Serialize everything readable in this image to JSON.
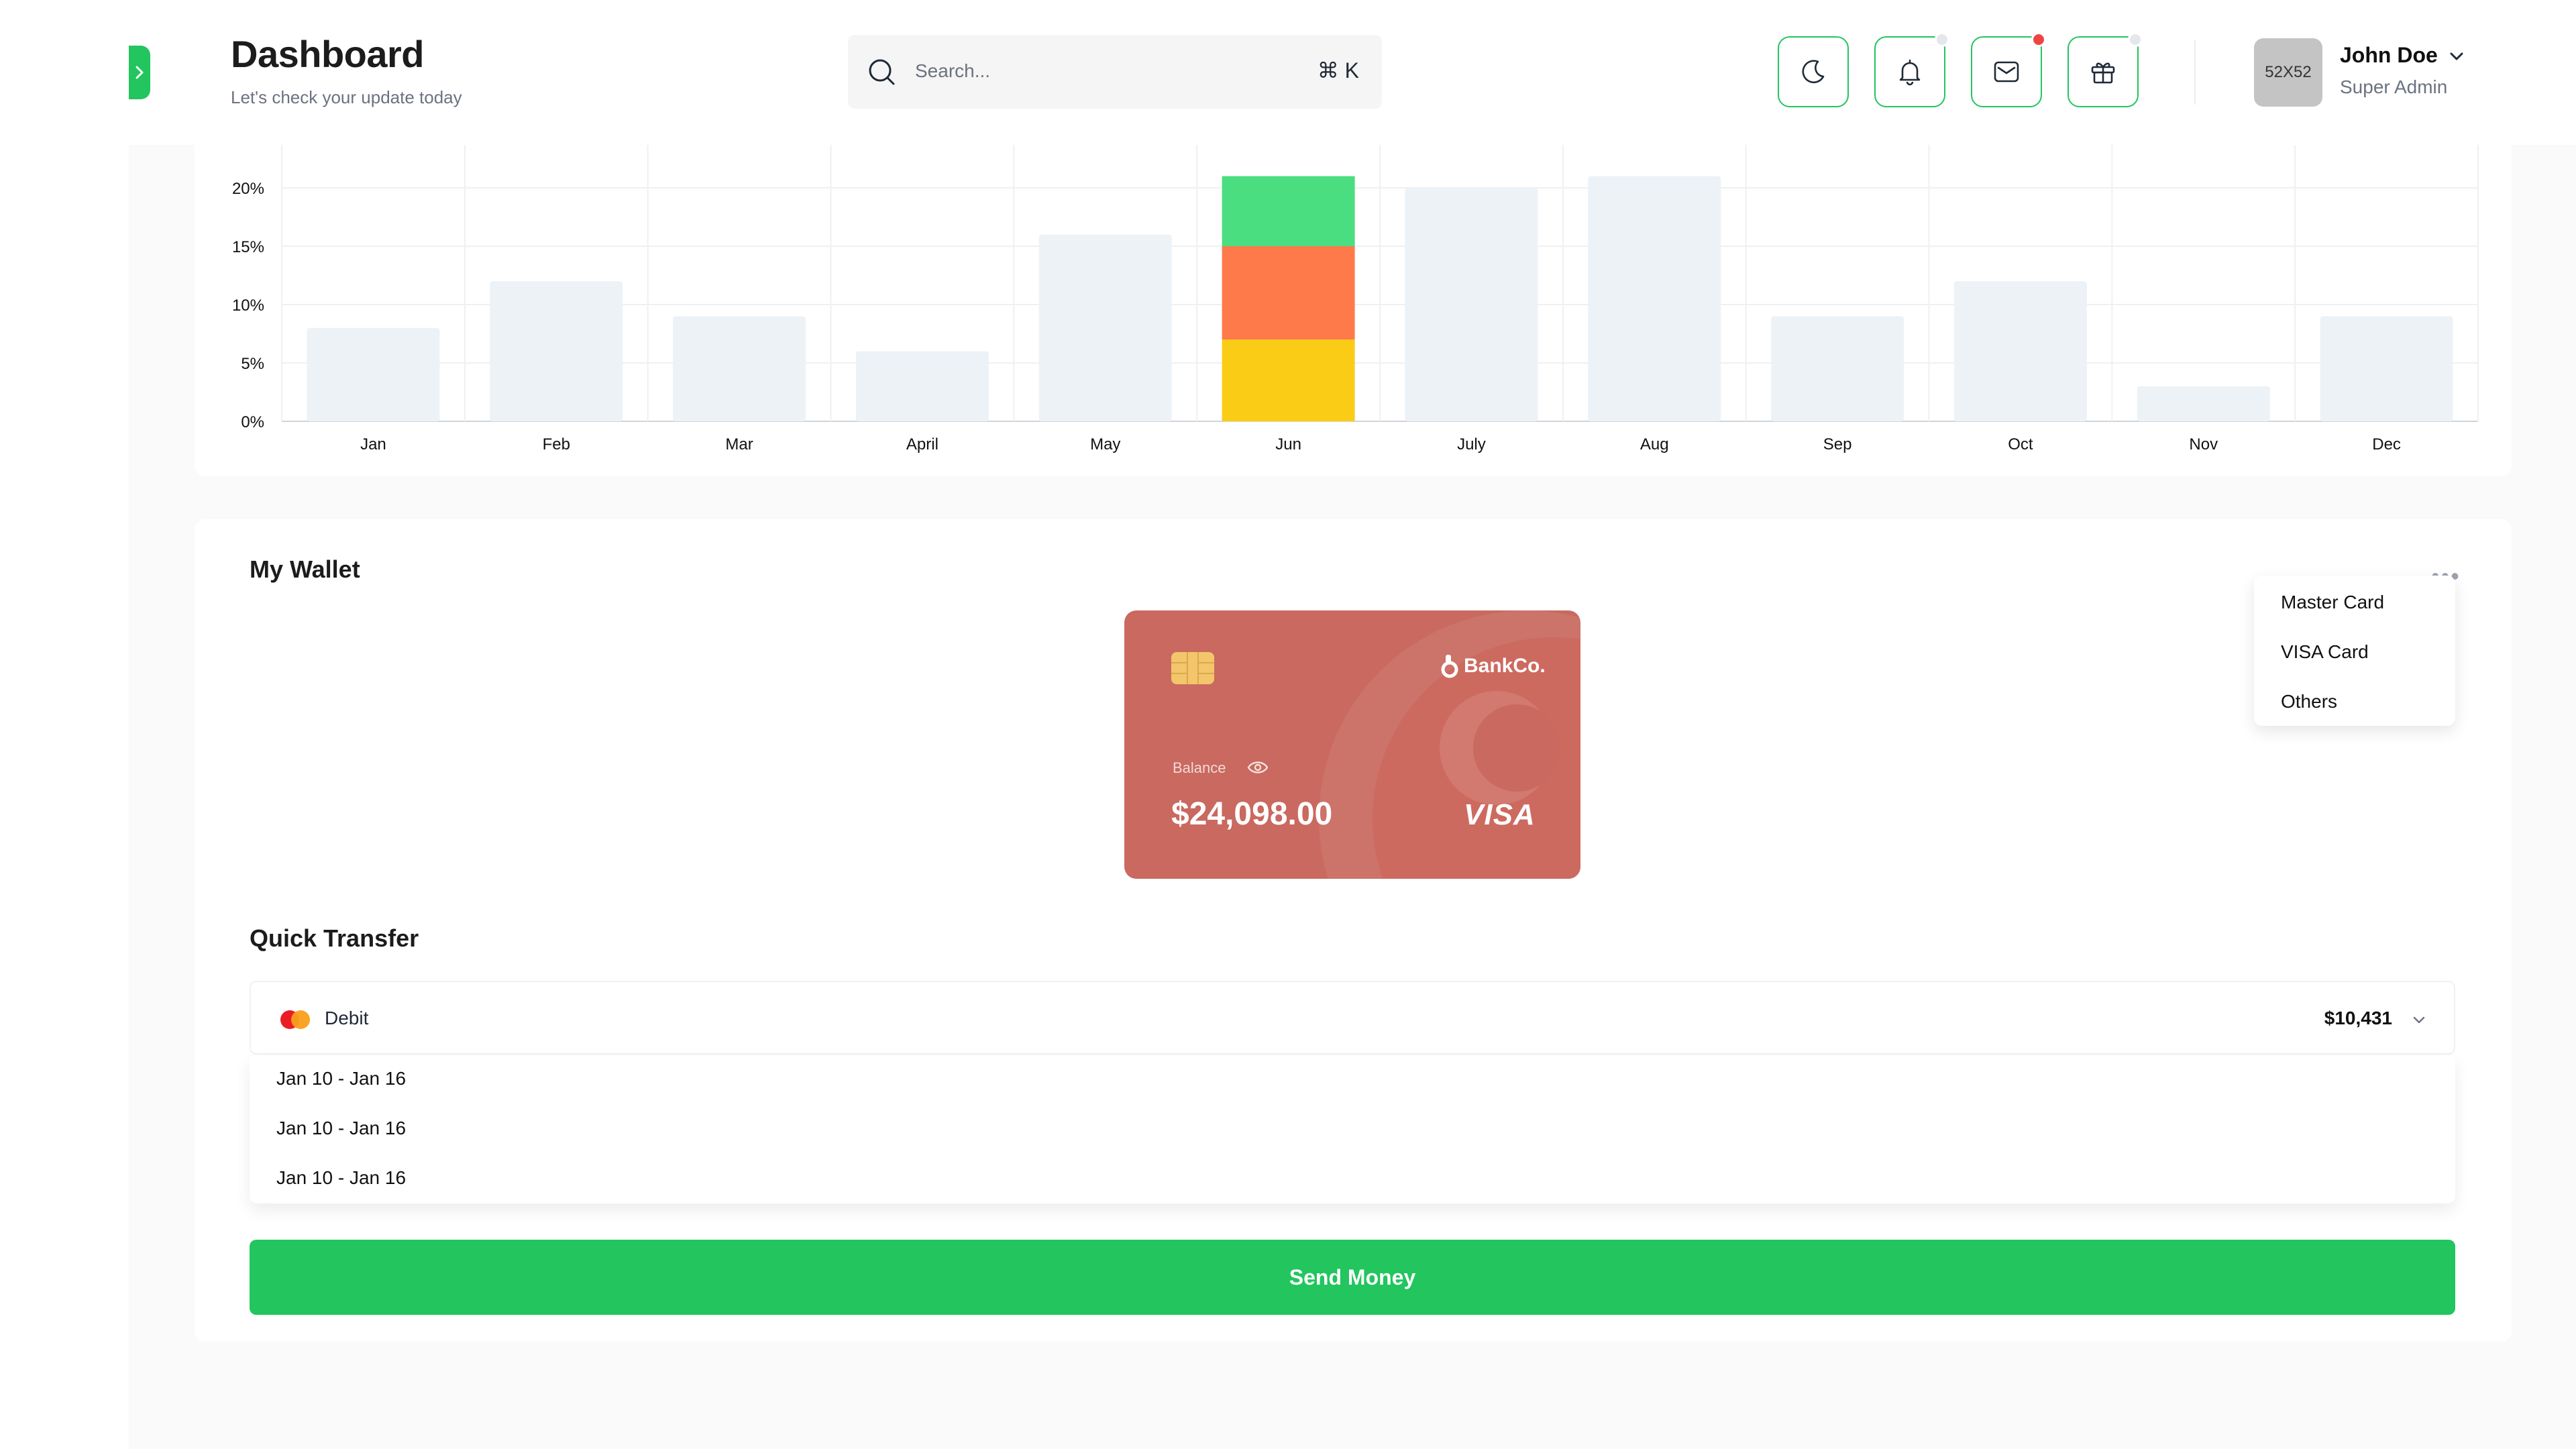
{
  "header": {
    "title": "Dashboard",
    "subtitle": "Let's check your update today",
    "search_placeholder": "Search...",
    "search_shortcut": "⌘ K",
    "avatar_text": "52X52",
    "user_name": "John Doe",
    "user_role": "Super Admin",
    "icons": [
      "moon-icon",
      "bell-icon",
      "mail-icon",
      "gift-icon"
    ],
    "badge_colors": {
      "notifications": "#e5e7eb",
      "messages": "#ef4444",
      "gifts": "#e5e7eb"
    }
  },
  "chart_data": {
    "type": "bar",
    "categories": [
      "Jan",
      "Feb",
      "Mar",
      "April",
      "May",
      "Jun",
      "July",
      "Aug",
      "Sep",
      "Oct",
      "Nov",
      "Dec"
    ],
    "values": [
      8,
      12,
      9,
      6,
      16,
      21,
      20,
      21,
      9,
      12,
      3,
      9
    ],
    "highlight": {
      "category": "Jun",
      "segments": [
        {
          "value": 7,
          "color": "#facc15"
        },
        {
          "value": 8,
          "color": "#ff7a4a"
        },
        {
          "value": 6,
          "color": "#4ade80"
        }
      ]
    },
    "yticks": [
      "0%",
      "5%",
      "10%",
      "15%",
      "20%"
    ],
    "ylim": [
      0,
      24
    ],
    "bar_color": "#edf2f7",
    "grid": true
  },
  "wallet": {
    "title": "My Wallet",
    "menu_items": [
      "Master Card",
      "VISA Card",
      "Others"
    ],
    "card": {
      "bank_name": "BankCo.",
      "balance_label": "Balance",
      "balance": "$24,098.00",
      "network": "VISA",
      "color": "#c9695f"
    }
  },
  "transfer": {
    "title": "Quick Transfer",
    "account_label": "Debit",
    "amount": "$10,431",
    "date_options": [
      "Jan 10 - Jan 16",
      "Jan 10 - Jan 16",
      "Jan 10 - Jan 16"
    ],
    "send_label": "Send Money"
  }
}
